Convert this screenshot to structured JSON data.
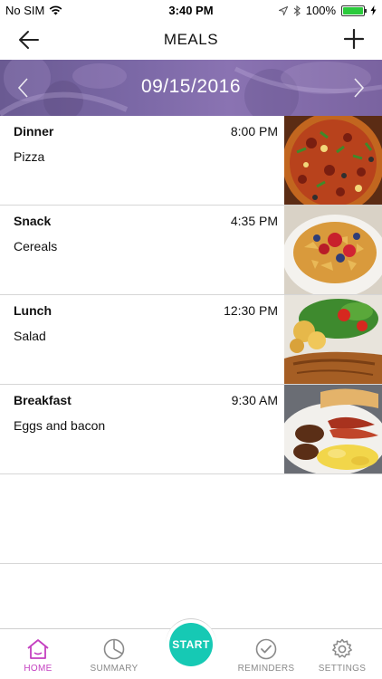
{
  "status_bar": {
    "carrier": "No SIM",
    "time": "3:40 PM",
    "battery_percent": "100%",
    "battery_level": 1.0,
    "icons": [
      "wifi-icon",
      "location-arrow-icon",
      "bluetooth-icon",
      "battery-icon",
      "charging-icon"
    ]
  },
  "nav": {
    "title": "MEALS",
    "back_icon": "arrow-left-icon",
    "add_icon": "plus-icon"
  },
  "date_nav": {
    "date": "09/15/2016",
    "prev_icon": "chevron-left-icon",
    "next_icon": "chevron-right-icon"
  },
  "meals": [
    {
      "name": "Dinner",
      "time": "8:00 PM",
      "description": "Pizza",
      "photo": "pizza-photo"
    },
    {
      "name": "Snack",
      "time": "4:35 PM",
      "description": "Cereals",
      "photo": "cereal-photo"
    },
    {
      "name": "Lunch",
      "time": "12:30 PM",
      "description": "Salad",
      "photo": "salad-photo"
    },
    {
      "name": "Breakfast",
      "time": "9:30 AM",
      "description": "Eggs and bacon",
      "photo": "breakfast-photo"
    }
  ],
  "tab_bar": {
    "tabs": [
      {
        "label": "HOME",
        "icon": "home-icon",
        "active": true
      },
      {
        "label": "SUMMARY",
        "icon": "pie-chart-icon",
        "active": false
      },
      {
        "label": "REMINDERS",
        "icon": "check-circle-icon",
        "active": false
      },
      {
        "label": "SETTINGS",
        "icon": "gear-icon",
        "active": false
      }
    ],
    "start_label": "START"
  },
  "colors": {
    "accent": "#c43fc0",
    "start_button": "#16c9b4",
    "banner": "#7b68a6"
  }
}
